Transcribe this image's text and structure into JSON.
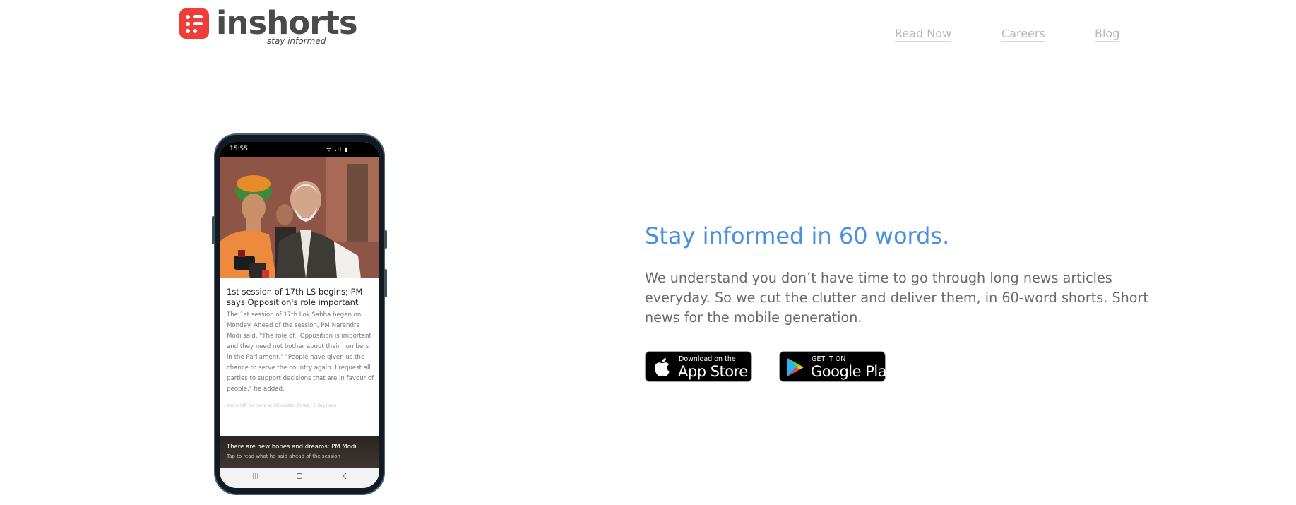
{
  "header": {
    "logo_word": "inshorts",
    "logo_tagline": "stay informed",
    "nav": [
      "Read Now",
      "Careers",
      "Blog"
    ]
  },
  "phone": {
    "status_time": "15:55",
    "status_icons": "ᯤ .ıl ▮",
    "article": {
      "title": "1st session of 17th LS begins; PM says Opposition's role important",
      "body": "The 1st session of 17th Lok Sabha began on Monday. Ahead of the session, PM Narendra Modi said, \"The role of...Opposition is important and they need not bother about their numbers in the Parliament.\" \"People have given us the chance to serve the country again. I request all parties to support decisions that are in favour of people,\" he added.",
      "source": "swipe left for more at Hindustan Times / 2 days ago"
    },
    "footer_card": {
      "title": "There are new hopes and dreams: PM Modi",
      "subtitle": "Tap to read what he said ahead of the session"
    },
    "nav_icons": [
      "recent-apps-icon",
      "home-icon",
      "back-icon"
    ]
  },
  "hero": {
    "headline": "Stay informed in 60 words.",
    "description": "We understand you don’t have time to go through long news articles everyday. So we cut the clutter and deliver them, in 60-word shorts. Short news for the mobile generation."
  },
  "store_buttons": {
    "app_store": {
      "small": "Download on the",
      "big": "App Store"
    },
    "google_play": {
      "small": "GET IT ON",
      "big": "Google Play"
    }
  },
  "colors": {
    "brand_red": "#ef3e3a",
    "headline_blue": "#4a90e2",
    "nav_gray": "#b8b8b8",
    "body_gray": "#6a6a6a"
  }
}
